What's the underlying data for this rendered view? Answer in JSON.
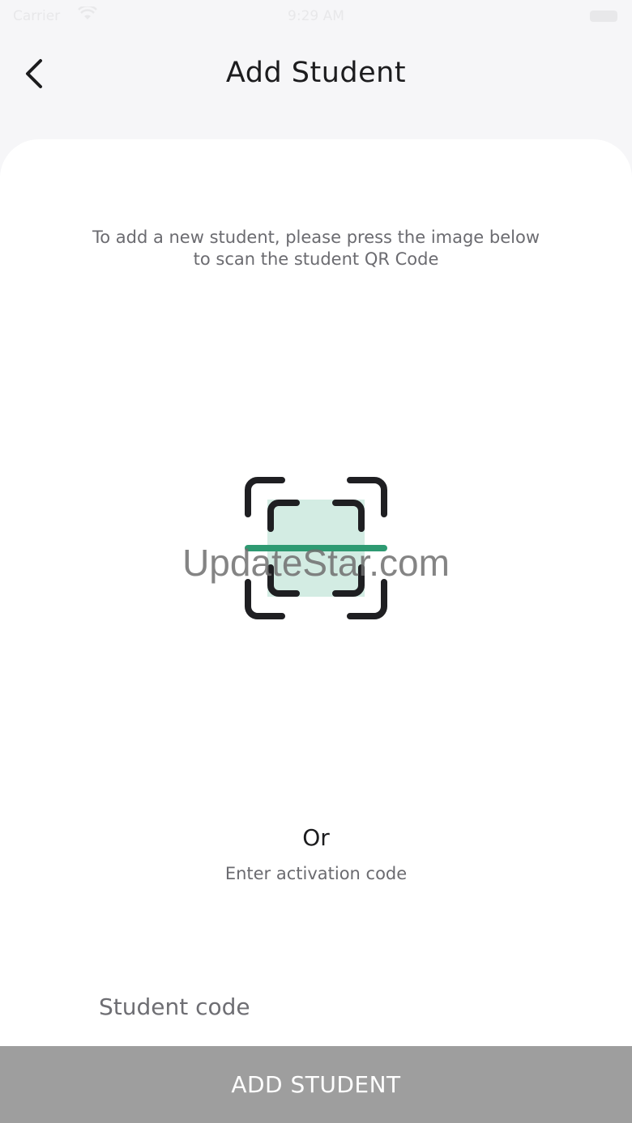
{
  "status_bar": {
    "carrier": "Carrier",
    "time": "9:29 AM"
  },
  "nav": {
    "title": "Add Student"
  },
  "main": {
    "instructions_line1": "To add a new student, please press the image below",
    "instructions_line2": "to scan the student QR Code",
    "watermark": "UpdateStar.com",
    "or_label": "Or",
    "activation_label": "Enter activation code",
    "code_placeholder": "Student code",
    "code_value": ""
  },
  "footer": {
    "add_button_label": "ADD STUDENT"
  },
  "colors": {
    "scan_line": "#2e9a72",
    "scan_fill": "#d3ece3",
    "bracket": "#1f1f22",
    "button_bg": "#9e9e9e"
  },
  "icons": {
    "back": "chevron-left-icon",
    "scan": "qr-scan-icon",
    "wifi": "wifi-icon",
    "battery": "battery-icon"
  }
}
